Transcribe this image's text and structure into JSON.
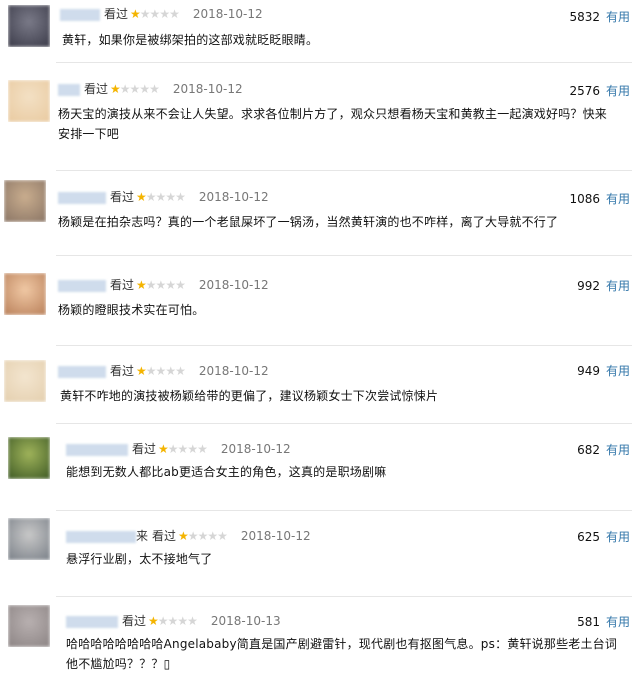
{
  "reviews": [
    {
      "user_suffix": "",
      "watched": "看过",
      "rating": 1,
      "max_rating": 5,
      "date": "2018-10-12",
      "votes": "5832",
      "useful": "有用",
      "comment": "黄轩，如果你是被绑架拍的这部戏就眨眨眼睛。",
      "avatar_colors": [
        "#7a7a88",
        "#3b3b49"
      ]
    },
    {
      "user_suffix": "",
      "watched": "看过",
      "rating": 1,
      "max_rating": 5,
      "date": "2018-10-12",
      "votes": "2576",
      "useful": "有用",
      "comment": "杨天宝的演技从来不会让人失望。求求各位制片方了，观众只想看杨天宝和黄教主一起演戏好吗？快来安排一下吧",
      "avatar_colors": [
        "#f3e0c4",
        "#e9caa0"
      ]
    },
    {
      "user_suffix": "",
      "watched": "看过",
      "rating": 1,
      "max_rating": 5,
      "date": "2018-10-12",
      "votes": "1086",
      "useful": "有用",
      "comment": "杨颖是在拍杂志吗？真的一个老鼠屎坏了一锅汤，当然黄轩演的也不咋样，离了大导就不行了",
      "avatar_colors": [
        "#c9ad8e",
        "#8a7565"
      ]
    },
    {
      "user_suffix": "",
      "watched": "看过",
      "rating": 1,
      "max_rating": 5,
      "date": "2018-10-12",
      "votes": "992",
      "useful": "有用",
      "comment": "杨颖的瞪眼技术实在可怕。",
      "avatar_colors": [
        "#f0c8a4",
        "#b9805a"
      ]
    },
    {
      "user_suffix": "",
      "watched": "看过",
      "rating": 1,
      "max_rating": 5,
      "date": "2018-10-12",
      "votes": "949",
      "useful": "有用",
      "comment": "黄轩不咋地的演技被杨颖给带的更偏了，建议杨颖女士下次尝试惊悚片",
      "avatar_colors": [
        "#f3e5cf",
        "#e4cfae"
      ]
    },
    {
      "user_suffix": "",
      "watched": "看过",
      "rating": 1,
      "max_rating": 5,
      "date": "2018-10-12",
      "votes": "682",
      "useful": "有用",
      "comment": "能想到无数人都比ab更适合女主的角色，这真的是职场剧嘛",
      "avatar_colors": [
        "#9fb35a",
        "#3e5a25"
      ]
    },
    {
      "user_suffix": "来",
      "watched": "看过",
      "rating": 1,
      "max_rating": 5,
      "date": "2018-10-12",
      "votes": "625",
      "useful": "有用",
      "comment": "悬浮行业剧，太不接地气了",
      "avatar_colors": [
        "#c8c8c8",
        "#7a8088"
      ]
    },
    {
      "user_suffix": "",
      "watched": "看过",
      "rating": 1,
      "max_rating": 5,
      "date": "2018-10-13",
      "votes": "581",
      "useful": "有用",
      "comment": "哈哈哈哈哈哈哈哈Angelababy简直是国产剧避雷针，现代剧也有抠图气息。ps：黄轩说那些老土台词他不尴尬吗？？？▯",
      "avatar_colors": [
        "#b8b0b0",
        "#8c8484"
      ]
    }
  ]
}
